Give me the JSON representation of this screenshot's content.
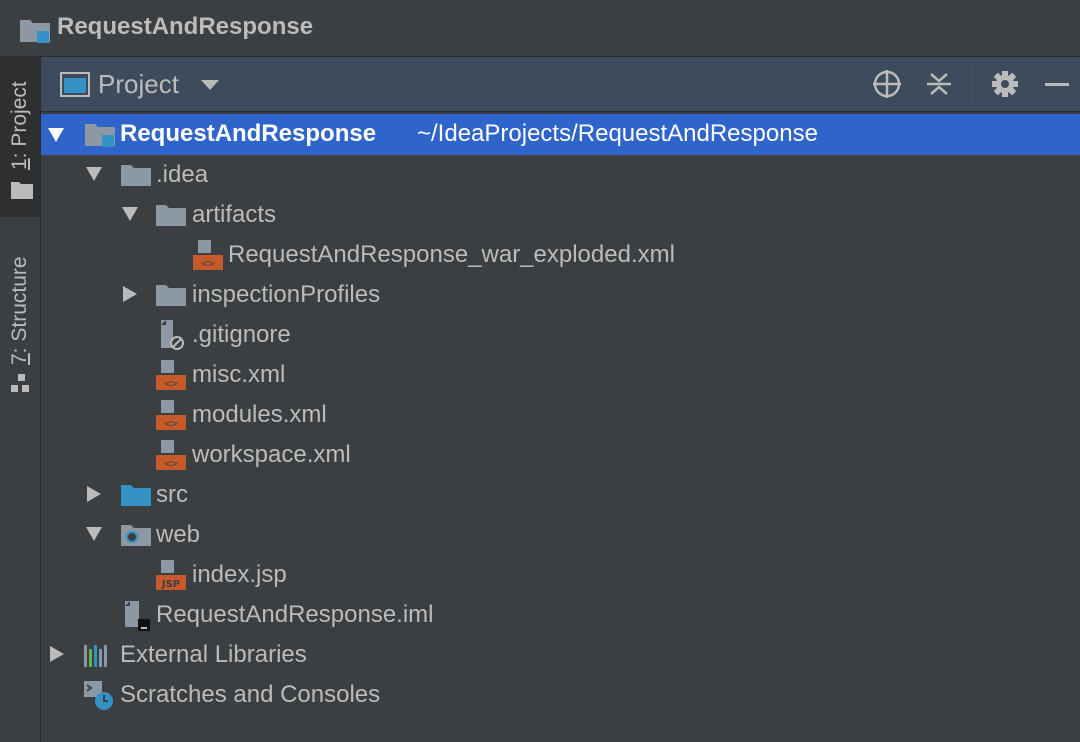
{
  "window": {
    "title": "RequestAndResponse"
  },
  "tool_strip": {
    "tabs": [
      {
        "number": "1",
        "label": ": Project",
        "active": true
      },
      {
        "number": "7",
        "label": ": Structure",
        "active": false
      }
    ]
  },
  "panel": {
    "title": "Project",
    "buttons": [
      "locate-icon",
      "collapse-all-icon",
      "gear-icon",
      "hide-icon"
    ]
  },
  "tree": {
    "root": {
      "name": "RequestAndResponse",
      "path": "~/IdeaProjects/RequestAndResponse"
    },
    "idea": ".idea",
    "artifacts": "artifacts",
    "war_exploded": "RequestAndResponse_war_exploded.xml",
    "inspection_profiles": "inspectionProfiles",
    "gitignore": ".gitignore",
    "misc": "misc.xml",
    "modules": "modules.xml",
    "workspace": "workspace.xml",
    "src": "src",
    "web": "web",
    "index_jsp": "index.jsp",
    "iml": "RequestAndResponse.iml",
    "external_libraries": "External Libraries",
    "scratches": "Scratches and Consoles"
  },
  "colors": {
    "background": "#3c3f41",
    "header": "#3d4b5c",
    "selection": "#2f65ca",
    "text": "#bbbbbb",
    "xml_orange": "#c75a2a",
    "source_blue": "#3592c4"
  }
}
